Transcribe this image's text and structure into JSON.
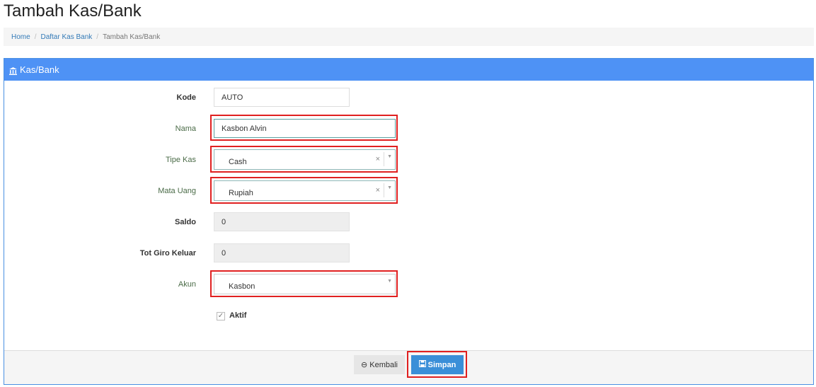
{
  "page": {
    "title": "Tambah Kas/Bank"
  },
  "breadcrumb": {
    "items": [
      "Home",
      "Daftar Kas Bank",
      "Tambah Kas/Bank"
    ],
    "separator": "/"
  },
  "panel": {
    "title": "Kas/Bank",
    "icon": "bank-icon",
    "header_color": "#4e92f5"
  },
  "form": {
    "kode": {
      "label": "Kode",
      "value": "AUTO"
    },
    "nama": {
      "label": "Nama",
      "value": "Kasbon Alvin"
    },
    "tipe_kas": {
      "label": "Tipe Kas",
      "value": "Cash",
      "clear": "×",
      "arrow": "▼"
    },
    "mata_uang": {
      "label": "Mata Uang",
      "value": "Rupiah",
      "clear": "×",
      "arrow": "▼"
    },
    "saldo": {
      "label": "Saldo",
      "value": "0"
    },
    "tot_giro_keluar": {
      "label": "Tot Giro Keluar",
      "value": "0"
    },
    "akun": {
      "label": "Akun",
      "value": "Kasbon",
      "arrow": "▼"
    },
    "aktif": {
      "label": "Aktif",
      "checked": true,
      "check_glyph": "✓"
    }
  },
  "actions": {
    "back": {
      "label": "Kembali",
      "icon": "arrow-circle-left-icon",
      "glyph": "⊖"
    },
    "save": {
      "label": "Simpan",
      "icon": "floppy-disk-icon",
      "glyph": "🖫"
    }
  },
  "colors": {
    "highlight": "#e02020",
    "primary": "#3a8fd8"
  }
}
